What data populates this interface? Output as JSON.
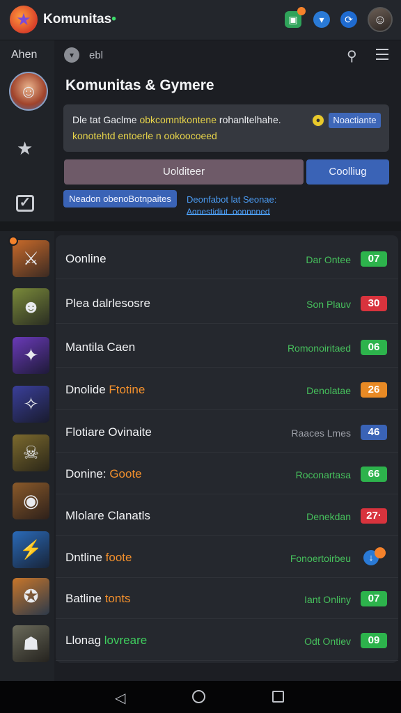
{
  "app": {
    "title": "Komunitas",
    "title_dot": "•"
  },
  "top_icons": [
    "chat-icon",
    "shield-icon",
    "sync-icon"
  ],
  "sidebar": {
    "label": "Ahen"
  },
  "header": {
    "text": "ebl"
  },
  "community": {
    "title": "Komunitas & Gymere"
  },
  "notice": {
    "line1_prefix": "Dle tat Gaclme ",
    "line1_highlight": "obkcomntkontene",
    "line1_suffix": " rohanltelhahe.",
    "line2": "konotehtd  entoerle n ookoocoeed",
    "button": "Noactiante"
  },
  "actions": {
    "primary": "Uolditeer",
    "continue": "Coolliug"
  },
  "chip": "Neadon obenoBotnpaites",
  "link": {
    "line1": "Deonfabot lat Seonae:",
    "line2": "Agnestidiut_oonnnnedlll"
  },
  "rows": [
    {
      "title": "Oonline",
      "title_extra": "",
      "extra_color": "",
      "status": "Dar Ontee",
      "status_color": "green",
      "badge": "07",
      "badge_color": "green"
    },
    {
      "title": "Plea dalrlesosre",
      "title_extra": "",
      "extra_color": "",
      "status": "Son Plauv",
      "status_color": "green",
      "badge": "30",
      "badge_color": "red"
    },
    {
      "title": "Mantila Caen",
      "title_extra": "",
      "extra_color": "",
      "status": "Romonoiritaed",
      "status_color": "green",
      "badge": "06",
      "badge_color": "green"
    },
    {
      "title": "Dnolide ",
      "title_extra": "Ftotine",
      "extra_color": "orange",
      "status": "Denolatae",
      "status_color": "green",
      "badge": "26",
      "badge_color": "orange"
    },
    {
      "title": "Flotiare Ovinaite",
      "title_extra": "",
      "extra_color": "",
      "status": "Raaces Lmes",
      "status_color": "grey",
      "badge": "46",
      "badge_color": "blue"
    },
    {
      "title": "Donine: ",
      "title_extra": "Goote",
      "extra_color": "orange",
      "status": "Roconartasa",
      "status_color": "green",
      "badge": "66",
      "badge_color": "green"
    },
    {
      "title": "Mlolare Clanatls",
      "title_extra": "",
      "extra_color": "",
      "status": "Denekdan",
      "status_color": "green",
      "badge": "27·",
      "badge_color": "red"
    },
    {
      "title": "Dntline ",
      "title_extra": "foote",
      "extra_color": "orange",
      "status": "Fonoertoirbeu",
      "status_color": "green",
      "badge": "",
      "badge_color": ""
    },
    {
      "title": "Batline ",
      "title_extra": "tonts",
      "extra_color": "orange",
      "status": "Iant Onliny",
      "status_color": "green",
      "badge": "07",
      "badge_color": "green"
    },
    {
      "title": "Llonag ",
      "title_extra": "lovreare",
      "extra_color": "green",
      "status": "Odt Ontiev",
      "status_color": "green",
      "badge": "09",
      "badge_color": "green"
    }
  ],
  "colors": {
    "accent": "#3a63b6",
    "online": "#46c05c",
    "warning": "#e88a25",
    "alert": "#d8333d"
  }
}
